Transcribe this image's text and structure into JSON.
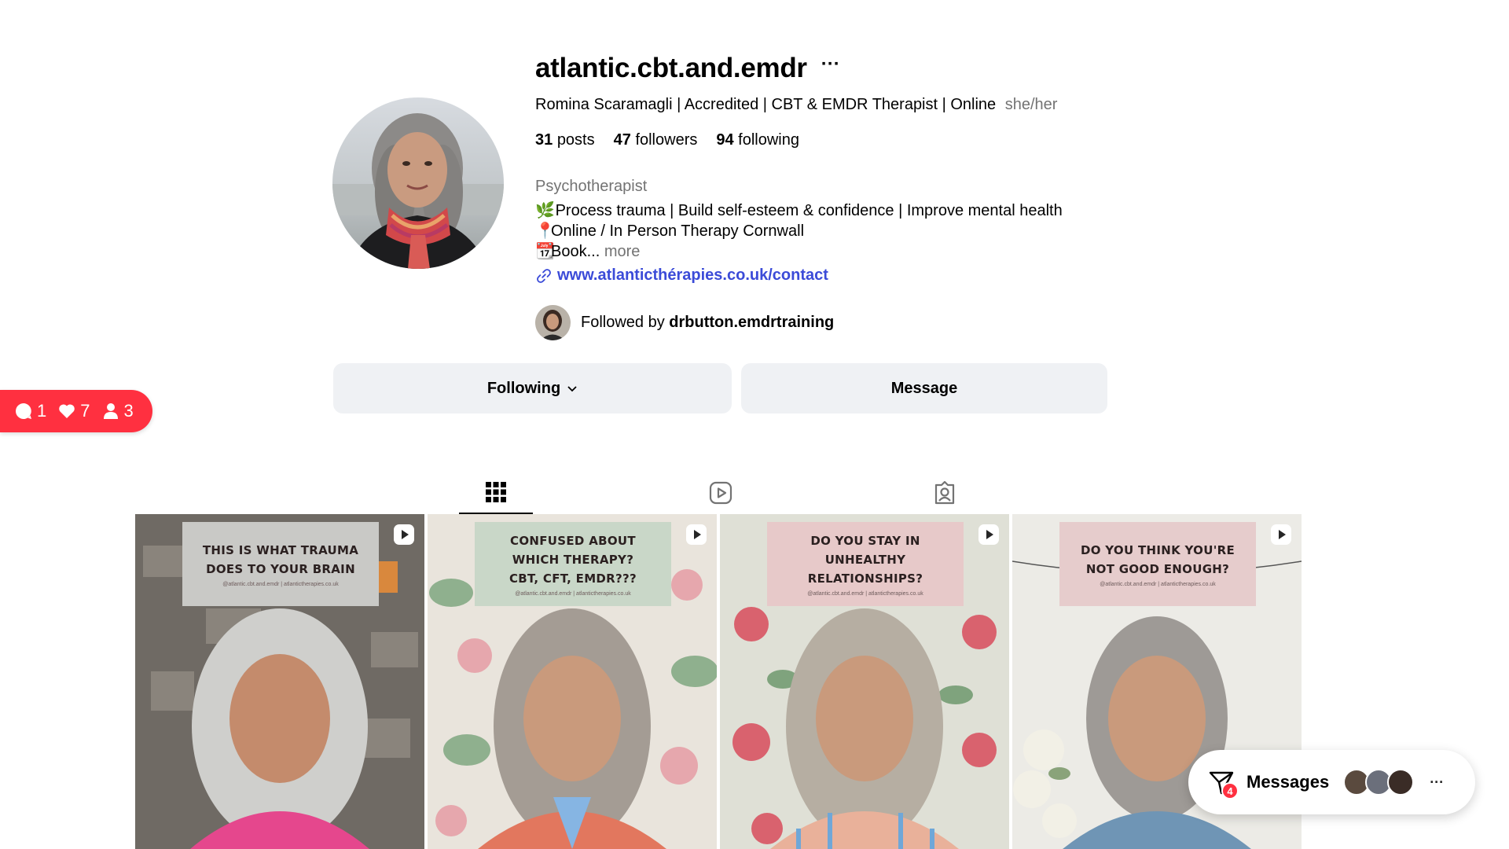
{
  "profile": {
    "username": "atlantic.cbt.and.emdr",
    "options_label": "···",
    "full_name": "Romina Scaramagli | Accredited | CBT & EMDR Therapist | Online",
    "pronouns": "she/her",
    "stats": {
      "posts_count": "31",
      "posts_label": "posts",
      "followers_count": "47",
      "followers_label": "followers",
      "following_count": "94",
      "following_label": "following"
    },
    "category": "Psychotherapist",
    "bio": {
      "line1_emoji": "🌿",
      "line1": "Process trauma | Build self-esteem & confidence | Improve mental health",
      "line2_emoji": "📍",
      "line2": "Online / In Person Therapy Cornwall",
      "line3_emoji": "📆",
      "line3": "Book...",
      "more": " more"
    },
    "link": "www.atlanticthérapies.co.uk/contact",
    "followed_by_prefix": "Followed by ",
    "followed_by_user": "drbutton.emdrtraining"
  },
  "actions": {
    "following_label": "Following",
    "message_label": "Message"
  },
  "notifications": {
    "comments": "1",
    "likes": "7",
    "follows": "3"
  },
  "tabs": {
    "posts_icon": "grid-icon",
    "reels_icon": "reels-icon",
    "tagged_icon": "tagged-icon"
  },
  "posts": [
    {
      "caption": "This is what trauma\ndoes to your brain",
      "sub": "@atlantic.cbt.and.emdr | atlantictherapies.co.uk",
      "box_color": "#c9c9c6"
    },
    {
      "caption": "Confused about\nwhich therapy?\nCBT, CFT, EMDR???",
      "sub": "@atlantic.cbt.and.emdr | atlantictherapies.co.uk",
      "box_color": "#c9d7c8"
    },
    {
      "caption": "Do you stay in\nunhealthy\nrelationships?",
      "sub": "@atlantic.cbt.and.emdr | atlantictherapies.co.uk",
      "box_color": "#e7c9c9"
    },
    {
      "caption": "Do you think you're\nnot good enough?",
      "sub": "@atlantic.cbt.and.emdr | atlantictherapies.co.uk",
      "box_color": "#e6cccc"
    }
  ],
  "messages": {
    "label": "Messages",
    "badge": "4",
    "more": "···"
  }
}
